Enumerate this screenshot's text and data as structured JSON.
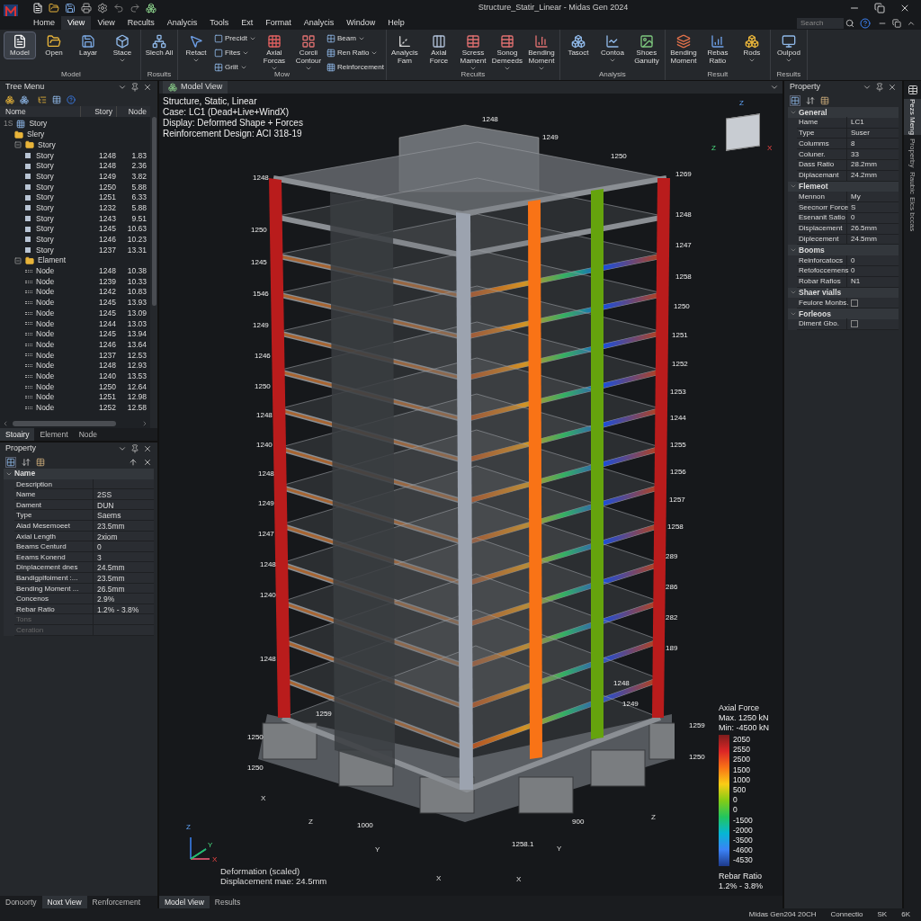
{
  "window": {
    "title": "Structure_Statir_Linear - Midas Gen 2024",
    "search": {
      "placeholder": "Search"
    }
  },
  "menu": [
    {
      "label": "Home",
      "selected": false
    },
    {
      "label": "View",
      "selected": true
    },
    {
      "label": "View",
      "selected": false
    },
    {
      "label": "Recults",
      "selected": false
    },
    {
      "label": "Analycis",
      "selected": false
    },
    {
      "label": "Tools",
      "selected": false
    },
    {
      "label": "Ext",
      "selected": false
    },
    {
      "label": "Format",
      "selected": false
    },
    {
      "label": "Analycis",
      "selected": false
    },
    {
      "label": "Window",
      "selected": false
    },
    {
      "label": "Help",
      "selected": false
    }
  ],
  "ribbon": [
    {
      "label": "Model",
      "items": [
        {
          "kind": "large",
          "label": "Model",
          "selected": true
        },
        {
          "kind": "large",
          "label": "Open",
          "selected": false
        },
        {
          "kind": "large",
          "label": "Layar",
          "selected": false
        },
        {
          "kind": "large",
          "label": "Stace",
          "selected": false,
          "dropdown": true
        }
      ]
    },
    {
      "label": "Rosults",
      "items": [
        {
          "kind": "large",
          "label": "Slech All",
          "selected": false
        }
      ]
    },
    {
      "label": "Mow",
      "items": [
        {
          "kind": "large",
          "label": "Retact",
          "selected": false,
          "dropdown": true
        },
        {
          "kind": "small",
          "label": "Precidt",
          "dropdown": true
        },
        {
          "kind": "small",
          "label": "Fites",
          "dropdown": true
        },
        {
          "kind": "small",
          "label": "Griit",
          "dropdown": true
        },
        {
          "kind": "large",
          "label": "Axial Forcas",
          "selected": false,
          "dropdown": true
        },
        {
          "kind": "large",
          "label": "Corcii Contour",
          "selected": false,
          "dropdown": true
        },
        {
          "kind": "small",
          "label": "Beam",
          "dropdown": true
        },
        {
          "kind": "small",
          "label": "Ren Ratio",
          "dropdown": true
        },
        {
          "kind": "small",
          "label": "Reinforcement"
        }
      ]
    },
    {
      "label": "Recuits",
      "items": [
        {
          "kind": "large",
          "label": "Analycis Fam",
          "selected": false
        },
        {
          "kind": "large",
          "label": "Axial Force",
          "selected": false
        },
        {
          "kind": "large",
          "label": "Scress Mament",
          "selected": false,
          "dropdown": true
        },
        {
          "kind": "large",
          "label": "Sonog Demeeds",
          "selected": false,
          "dropdown": true
        },
        {
          "kind": "large",
          "label": "Bending Moment",
          "selected": false,
          "dropdown": true
        }
      ]
    },
    {
      "label": "Analysis",
      "items": [
        {
          "kind": "large",
          "label": "Tasoct",
          "selected": false
        },
        {
          "kind": "large",
          "label": "Contoa",
          "selected": false,
          "dropdown": true
        },
        {
          "kind": "large",
          "label": "Shoes Ganuity",
          "selected": false
        }
      ]
    },
    {
      "label": "Result",
      "items": [
        {
          "kind": "large",
          "label": "Bending Moment",
          "selected": false
        },
        {
          "kind": "large",
          "label": "Rebas Ratio",
          "selected": false
        },
        {
          "kind": "large",
          "label": "Rods",
          "selected": false,
          "dropdown": true
        }
      ]
    },
    {
      "label": "Results",
      "items": [
        {
          "kind": "large",
          "label": "Oulpod",
          "selected": false,
          "dropdown": true
        }
      ]
    }
  ],
  "tree_menu": {
    "title": "Tree Menu",
    "columns": [
      "Nome",
      "Story",
      "Node"
    ],
    "root": {
      "prefix": "1S",
      "name": "Story",
      "children": [
        {
          "name": "Slery",
          "kind": "folder"
        },
        {
          "name": "Story",
          "kind": "folder",
          "expanded": true,
          "children": [
            {
              "kind": "story",
              "name": "Story",
              "story": "1248",
              "node": "1.83"
            },
            {
              "kind": "story",
              "name": "Story",
              "story": "1248",
              "node": "2.36"
            },
            {
              "kind": "story",
              "name": "Story",
              "story": "1249",
              "node": "3.82"
            },
            {
              "kind": "story",
              "name": "Story",
              "story": "1250",
              "node": "5.88"
            },
            {
              "kind": "story",
              "name": "Story",
              "story": "1251",
              "node": "6.33"
            },
            {
              "kind": "story",
              "name": "Story",
              "story": "1232",
              "node": "5.88"
            },
            {
              "kind": "story",
              "name": "Story",
              "story": "1243",
              "node": "9.51"
            },
            {
              "kind": "story",
              "name": "Story",
              "story": "1245",
              "node": "10.63"
            },
            {
              "kind": "story",
              "name": "Story",
              "story": "1246",
              "node": "10.23"
            },
            {
              "kind": "story",
              "name": "Story",
              "story": "1237",
              "node": "13.31"
            }
          ]
        },
        {
          "name": "Elament",
          "kind": "folder",
          "expanded": true,
          "children": [
            {
              "kind": "node",
              "name": "Node",
              "story": "1248",
              "node": "10.38"
            },
            {
              "kind": "node",
              "name": "Node",
              "story": "1239",
              "node": "10.33"
            },
            {
              "kind": "node",
              "name": "Node",
              "story": "1242",
              "node": "10.83"
            },
            {
              "kind": "node",
              "name": "Node",
              "story": "1245",
              "node": "13.93"
            },
            {
              "kind": "node",
              "name": "Node",
              "story": "1245",
              "node": "13.09"
            },
            {
              "kind": "node",
              "name": "Node",
              "story": "1244",
              "node": "13.03"
            },
            {
              "kind": "node",
              "name": "Node",
              "story": "1245",
              "node": "13.94"
            },
            {
              "kind": "node",
              "name": "Node",
              "story": "1246",
              "node": "13.64"
            },
            {
              "kind": "node",
              "name": "Node",
              "story": "1237",
              "node": "12.53"
            },
            {
              "kind": "node",
              "name": "Node",
              "story": "1248",
              "node": "12.93"
            },
            {
              "kind": "node",
              "name": "Node",
              "story": "1240",
              "node": "13.53"
            },
            {
              "kind": "node",
              "name": "Node",
              "story": "1250",
              "node": "12.64"
            },
            {
              "kind": "node",
              "name": "Node",
              "story": "1251",
              "node": "12.98"
            },
            {
              "kind": "node",
              "name": "Node",
              "story": "1252",
              "node": "12.58"
            }
          ]
        }
      ]
    },
    "tabs": [
      {
        "label": "Stoairy",
        "selected": true
      },
      {
        "label": "Element",
        "selected": false
      },
      {
        "label": "Node",
        "selected": false
      }
    ]
  },
  "left_property": {
    "title": "Property",
    "group": "Name",
    "rows": [
      {
        "label": "Description",
        "disabled": false
      },
      {
        "label": "Name",
        "value": "2SS",
        "disabled": false
      },
      {
        "label": "Dament",
        "value": "DUN",
        "disabled": false
      },
      {
        "label": "Type",
        "value": "Saems",
        "disabled": false
      },
      {
        "label": "Aiad Mesemoeet",
        "value": "23.5mm",
        "disabled": false
      },
      {
        "label": "Axial Length",
        "value": "2xiom",
        "disabled": false
      },
      {
        "label": "Beams Centurd",
        "value": "0",
        "disabled": false
      },
      {
        "label": "Eeams Konend",
        "value": "3",
        "disabled": false
      },
      {
        "label": "Dinplacement dnes",
        "value": "24.5mm",
        "disabled": false
      },
      {
        "label": "Bandigplfoiment :...",
        "value": "23.5mm",
        "disabled": false
      },
      {
        "label": "Bending Moment ...",
        "value": "26.5mm",
        "disabled": false
      },
      {
        "label": "Concenos",
        "value": "2.9%",
        "disabled": false
      },
      {
        "label": "Rebar Ratio",
        "value": "1.2% - 3.8%",
        "disabled": false
      },
      {
        "label": "Tons",
        "disabled": true
      },
      {
        "label": "Ceration",
        "disabled": true
      }
    ],
    "tabs": [
      {
        "label": "Donoorty",
        "selected": false
      },
      {
        "label": "Noxt View",
        "selected": true
      },
      {
        "label": "Renforcement",
        "selected": false
      }
    ]
  },
  "model_view": {
    "tab": "Model View",
    "info": [
      "Structure, Static, Linear",
      "Case: LC1 (Dead+Live+WindX)",
      "Display: Deformed Shape + Forces",
      "Reinforcement Design: ACI 318-19"
    ],
    "cube_axes": [
      "Z",
      "Z",
      "X"
    ],
    "node_labels": [
      "1248",
      "1249",
      "1250",
      "1269",
      "1248",
      "1250",
      "1245",
      "1546",
      "1249",
      "1246",
      "1250",
      "1248",
      "1240",
      "1248",
      "1249",
      "1247",
      "1248",
      "1240",
      "1248",
      "1248",
      "1247",
      "1258",
      "1250",
      "1251",
      "1252",
      "1253",
      "1244",
      "1255",
      "1256",
      "1257",
      "1258",
      "289",
      "286",
      "282",
      "189",
      "1248",
      "1249",
      "1259",
      "1250",
      "1259",
      "1250",
      "1250",
      "1000",
      "1258.1",
      "900"
    ],
    "axis_labels": [
      "X",
      "Z",
      "Y",
      "X",
      "X",
      "Y",
      "Z"
    ],
    "triad": [
      "Z",
      "Y",
      "X"
    ],
    "deformation": [
      "Deformation (scaled)",
      "Displacement mae: 24.5mm"
    ],
    "legend": {
      "title": "Axial Force",
      "max": "Max. 1250 kN",
      "min": "Min: -4500 kN",
      "values": [
        "2050",
        "2550",
        "2500",
        "1500",
        "1000",
        "500",
        "0",
        "0",
        "-1500",
        "-2000",
        "-3500",
        "-4600",
        "-4530"
      ],
      "footer": [
        "Rebar Ratio",
        "1.2% - 3.8%"
      ]
    },
    "tabs": [
      {
        "label": "Model View",
        "selected": true
      },
      {
        "label": "Results",
        "selected": false
      }
    ]
  },
  "right_property": {
    "title": "Property",
    "groups": [
      {
        "name": "General",
        "rows": [
          {
            "kind": "text",
            "label": "Hame",
            "value": "LC1"
          },
          {
            "kind": "text",
            "label": "Type",
            "value": "Suser"
          },
          {
            "kind": "text",
            "label": "Columms",
            "value": "8"
          },
          {
            "kind": "text",
            "label": "Coluner.",
            "value": "33"
          },
          {
            "kind": "text",
            "label": "Dass Ratio",
            "value": "28.2mm"
          },
          {
            "kind": "text",
            "label": "Diplacemant",
            "value": "24.2mm"
          }
        ]
      },
      {
        "name": "Flemeot",
        "rows": [
          {
            "kind": "text",
            "label": "Mennon",
            "value": "My"
          },
          {
            "kind": "text",
            "label": "Seecnorr Force",
            "value": "S"
          },
          {
            "kind": "text",
            "label": "Esenanit Satio",
            "value": "0"
          },
          {
            "kind": "text",
            "label": "Displacement",
            "value": "26.5mm"
          },
          {
            "kind": "text",
            "label": "Diplecement",
            "value": "24.5mm"
          }
        ]
      },
      {
        "name": "Booms",
        "rows": [
          {
            "kind": "text",
            "label": "Reinforcatocs",
            "value": "0"
          },
          {
            "kind": "text",
            "label": "Retofoccemens",
            "value": "0"
          },
          {
            "kind": "text",
            "label": "Robar Rafios",
            "value": "N1"
          }
        ]
      },
      {
        "name": "Shaer vialls",
        "rows": [
          {
            "kind": "checkbox",
            "label": "Feulore Monbs.",
            "checked": false
          }
        ]
      },
      {
        "name": "Forleoos",
        "rows": [
          {
            "kind": "checkbox",
            "label": "Diment Gbo.",
            "checked": false
          }
        ]
      }
    ]
  },
  "side_tabs": [
    {
      "label": "Pezs Meng",
      "selected": true
    },
    {
      "label": "Properby",
      "selected": false
    },
    {
      "label": "Raubic",
      "selected": false
    },
    {
      "label": "Elcs bccas",
      "selected": false
    }
  ],
  "status_bar": [
    "Midas Gen204 20CH",
    "Connectio",
    "SK",
    "6K"
  ]
}
